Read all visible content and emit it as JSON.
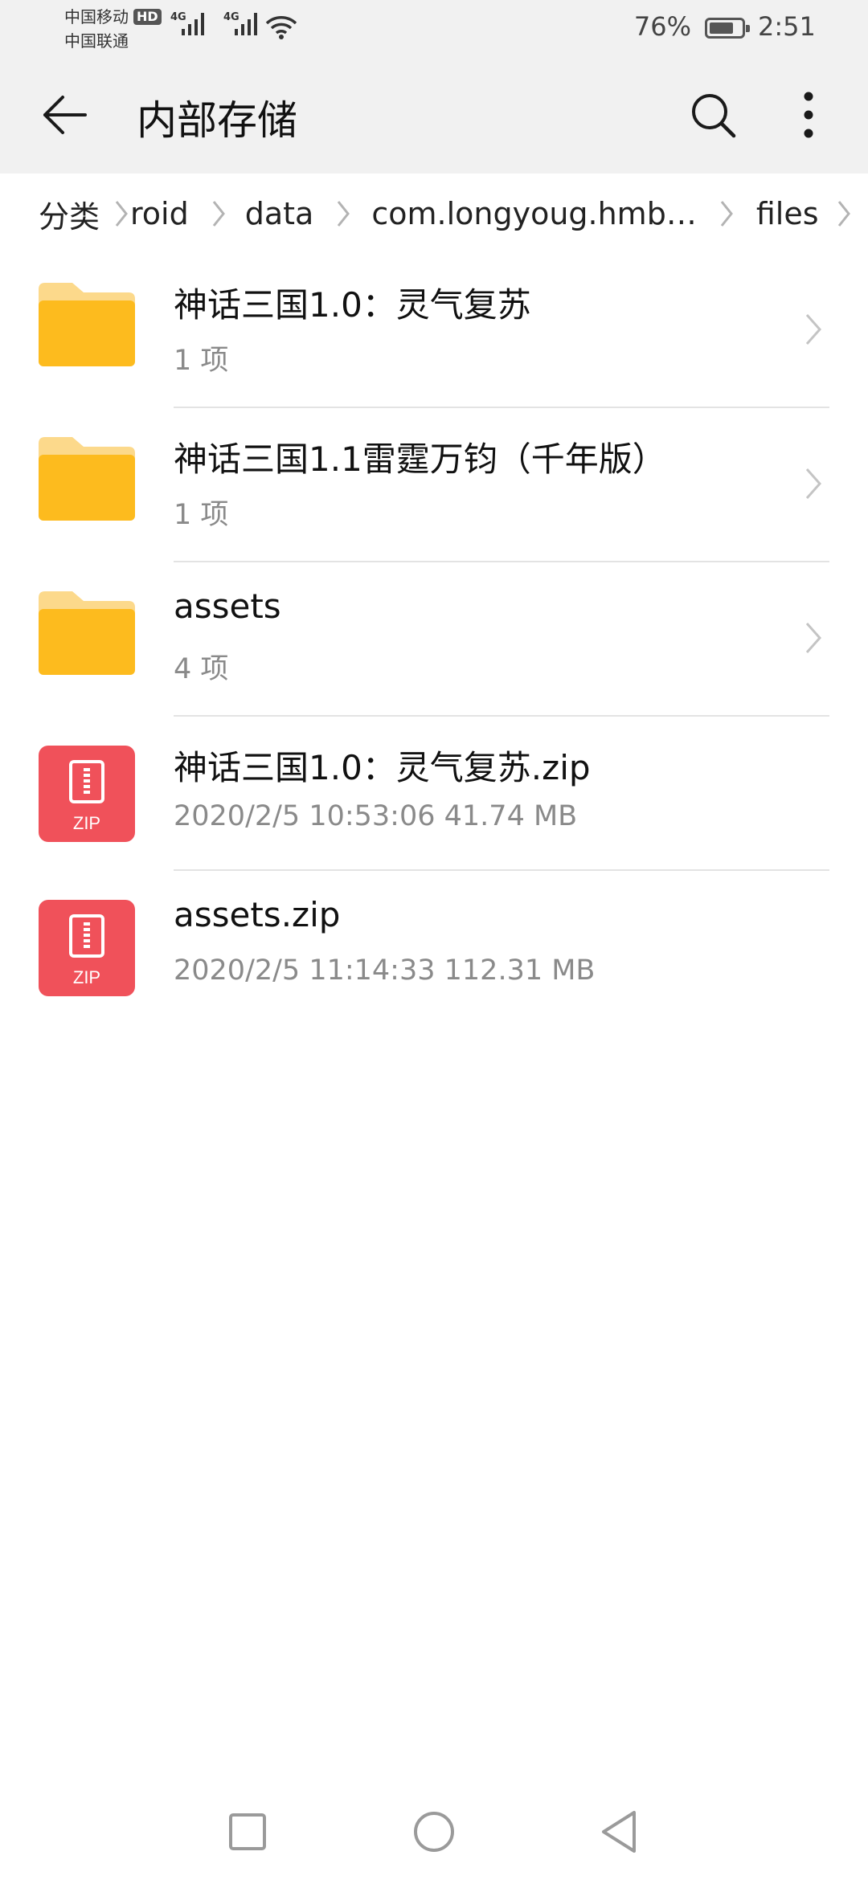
{
  "status_bar": {
    "carrier_1": "中国移动",
    "hd_badge": "HD",
    "carrier_2": "中国联通",
    "network_1": "4G",
    "network_2": "4G",
    "battery_percent": "76%",
    "battery_level": 0.76,
    "time": "2:51"
  },
  "app_bar": {
    "title": "内部存储",
    "back_icon": "arrow-left-icon",
    "search_icon": "search-icon",
    "more_icon": "more-vertical-icon"
  },
  "breadcrumb": [
    "分类",
    "roid",
    "data",
    "com.longyoug.hmb…",
    "files"
  ],
  "files": [
    {
      "name": "神话三国1.0：灵气复苏",
      "meta": "1 项",
      "type": "folder"
    },
    {
      "name": "神话三国1.1雷霆万钧（千年版）",
      "meta": "1 项",
      "type": "folder"
    },
    {
      "name": "assets",
      "meta": "4 项",
      "type": "folder"
    },
    {
      "name": "神话三国1.0：灵气复苏.zip",
      "meta": "2020/2/5 10:53:06 41.74 MB",
      "type": "zip",
      "icon_label": "ZIP"
    },
    {
      "name": "assets.zip",
      "meta": "2020/2/5 11:14:33 112.31 MB",
      "type": "zip",
      "icon_label": "ZIP"
    }
  ],
  "colors": {
    "folder_back": "#fcd98b",
    "folder_front": "#fdbb1e",
    "zip_bg": "#f0515a",
    "header_bg": "#f1f1f1"
  },
  "nav_bar": {
    "recent_icon": "square-icon",
    "home_icon": "circle-icon",
    "back_icon": "triangle-back-icon"
  }
}
